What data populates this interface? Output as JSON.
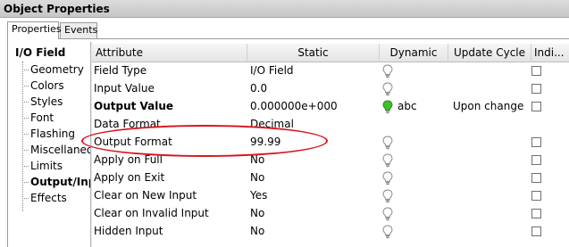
{
  "window": {
    "title": "Object Properties"
  },
  "tabs": [
    {
      "label": "Properties",
      "active": true
    },
    {
      "label": "Events",
      "active": false
    }
  ],
  "tree": {
    "root": "I/O Field",
    "items": [
      {
        "label": "Geometry",
        "selected": false
      },
      {
        "label": "Colors",
        "selected": false
      },
      {
        "label": "Styles",
        "selected": false
      },
      {
        "label": "Font",
        "selected": false
      },
      {
        "label": "Flashing",
        "selected": false
      },
      {
        "label": "Miscellaneo",
        "selected": false
      },
      {
        "label": "Limits",
        "selected": false
      },
      {
        "label": "Output/Inp",
        "selected": true
      },
      {
        "label": "Effects",
        "selected": false
      }
    ]
  },
  "table": {
    "headers": {
      "attribute": "Attribute",
      "static": "Static",
      "dynamic": "Dynamic",
      "update_cycle": "Update Cycle",
      "indirect": "Indi..."
    },
    "rows": [
      {
        "attribute": "Field Type",
        "static": "I/O Field",
        "bulb": "gray",
        "dynamic_text": "",
        "update_cycle": "",
        "checkbox": true,
        "bold": false
      },
      {
        "attribute": "Input Value",
        "static": "0.0",
        "bulb": "gray",
        "dynamic_text": "",
        "update_cycle": "",
        "checkbox": true,
        "bold": false
      },
      {
        "attribute": "Output Value",
        "static": "0.000000e+000",
        "bulb": "green",
        "dynamic_text": "abc",
        "update_cycle": "Upon change",
        "checkbox": true,
        "bold": true
      },
      {
        "attribute": "Data Format",
        "static": "Decimal",
        "bulb": "none",
        "dynamic_text": "",
        "update_cycle": "",
        "checkbox": false,
        "bold": false
      },
      {
        "attribute": "Output Format",
        "static": "99.99",
        "bulb": "gray",
        "dynamic_text": "",
        "update_cycle": "",
        "checkbox": true,
        "bold": false
      },
      {
        "attribute": "Apply on Full",
        "static": "No",
        "bulb": "gray",
        "dynamic_text": "",
        "update_cycle": "",
        "checkbox": true,
        "bold": false
      },
      {
        "attribute": "Apply on Exit",
        "static": "No",
        "bulb": "gray",
        "dynamic_text": "",
        "update_cycle": "",
        "checkbox": true,
        "bold": false
      },
      {
        "attribute": "Clear on New Input",
        "static": "Yes",
        "bulb": "gray",
        "dynamic_text": "",
        "update_cycle": "",
        "checkbox": true,
        "bold": false
      },
      {
        "attribute": "Clear on Invalid Input",
        "static": "No",
        "bulb": "gray",
        "dynamic_text": "",
        "update_cycle": "",
        "checkbox": true,
        "bold": false
      },
      {
        "attribute": "Hidden Input",
        "static": "No",
        "bulb": "gray",
        "dynamic_text": "",
        "update_cycle": "",
        "checkbox": true,
        "bold": false
      }
    ]
  },
  "colors": {
    "highlight_ellipse": "#d8141c",
    "bulb_gray": "#8c8c8c",
    "bulb_green": "#3fbf2a"
  },
  "icons": {
    "bulb": "lightbulb-icon",
    "checkbox": "checkbox-icon"
  }
}
